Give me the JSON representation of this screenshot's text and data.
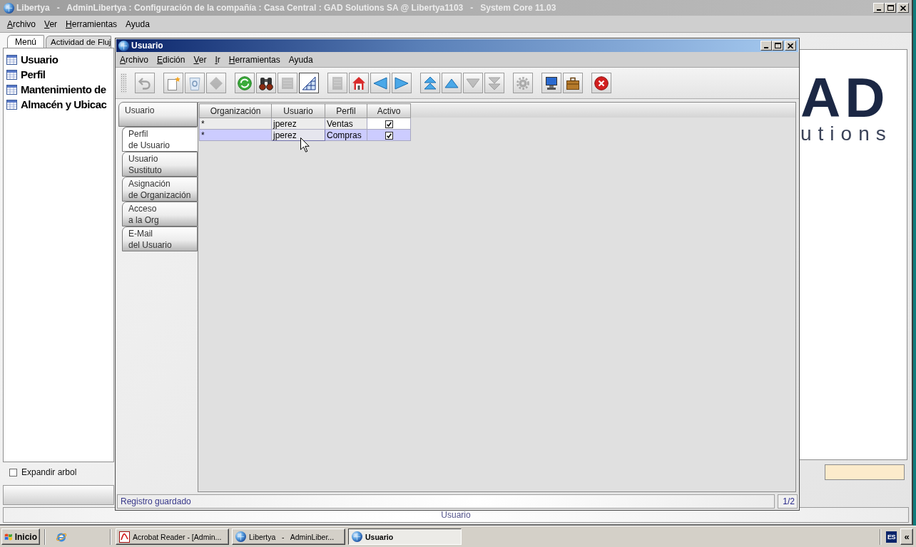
{
  "main_window": {
    "title": "Libertya   -   AdminLibertya : Configuración de la compañía : Casa Central : GAD Solutions SA @ Libertya1103   -   System Core 11.03",
    "menu": [
      {
        "label": "Archivo",
        "mnemonic": true
      },
      {
        "label": "Ver",
        "mnemonic": true
      },
      {
        "label": "Herramientas",
        "mnemonic": true
      },
      {
        "label": "Ayuda",
        "mnemonic": false
      }
    ],
    "tabs": [
      {
        "label": "Menú",
        "selected": true
      },
      {
        "label": "Actividad de Fluj",
        "selected": false
      }
    ],
    "tree": [
      {
        "label": "Usuario"
      },
      {
        "label": "Perfil"
      },
      {
        "label": "Mantenimiento de"
      },
      {
        "label": "Almacén y Ubicac"
      }
    ],
    "expand_tree": {
      "label": "Expandir arbol",
      "checked": false
    },
    "logo": {
      "letters": "AD",
      "subtitle": "utions"
    },
    "status_bar": {
      "text": "Usuario"
    }
  },
  "child_window": {
    "title": "Usuario",
    "menu": [
      {
        "label": "Archivo",
        "mnemonic": true
      },
      {
        "label": "Edición",
        "mnemonic": true
      },
      {
        "label": "Ver",
        "mnemonic": true
      },
      {
        "label": "Ir",
        "mnemonic": true
      },
      {
        "label": "Herramientas",
        "mnemonic": true
      },
      {
        "label": "Ayuda",
        "mnemonic": false
      }
    ],
    "toolbar": [
      [
        {
          "disabled": true,
          "pressed": false
        }
      ],
      [
        {
          "disabled": false,
          "pressed": false
        },
        {
          "disabled": false,
          "pressed": false
        },
        {
          "disabled": true,
          "pressed": false
        }
      ],
      [
        {
          "disabled": false,
          "pressed": false
        },
        {
          "disabled": false,
          "pressed": false
        },
        {
          "disabled": true,
          "pressed": false
        },
        {
          "disabled": false,
          "pressed": true
        }
      ],
      [
        {
          "disabled": true,
          "pressed": false
        },
        {
          "disabled": false,
          "pressed": false
        },
        {
          "disabled": false,
          "pressed": false
        },
        {
          "disabled": false,
          "pressed": false
        }
      ],
      [
        {
          "disabled": false,
          "pressed": false
        },
        {
          "disabled": false,
          "pressed": false
        },
        {
          "disabled": true,
          "pressed": false
        },
        {
          "disabled": true,
          "pressed": false
        }
      ],
      [
        {
          "disabled": true,
          "pressed": false
        }
      ],
      [
        {
          "disabled": false,
          "pressed": false
        },
        {
          "disabled": false,
          "pressed": false
        }
      ],
      [
        {
          "disabled": false,
          "pressed": false
        }
      ]
    ],
    "tabs": [
      {
        "label": "Usuario",
        "selected": false,
        "children": [
          {
            "label": "Perfil\nde Usuario",
            "selected": true
          },
          {
            "label": "Usuario\nSustituto",
            "selected": false
          },
          {
            "label": "Asignación\nde Organización",
            "selected": false
          },
          {
            "label": "Acceso\na la Org",
            "selected": false
          },
          {
            "label": "E-Mail\ndel Usuario",
            "selected": false
          }
        ]
      }
    ],
    "table": {
      "columns": [
        "Organización",
        "Usuario",
        "Perfil",
        "Activo"
      ],
      "rows": [
        {
          "selected": false,
          "cells": [
            {
              "kind": "text",
              "text": "*",
              "focused": false
            },
            {
              "kind": "text",
              "text": "jperez",
              "focused": false
            },
            {
              "kind": "text",
              "text": "Ventas",
              "focused": false
            },
            {
              "kind": "check",
              "checked": true,
              "focused": false
            }
          ]
        },
        {
          "selected": true,
          "cells": [
            {
              "kind": "text",
              "text": "*",
              "focused": false
            },
            {
              "kind": "text",
              "text": "jperez",
              "focused": true
            },
            {
              "kind": "text",
              "text": "Compras",
              "focused": false
            },
            {
              "kind": "check",
              "checked": true,
              "focused": false
            }
          ]
        }
      ]
    },
    "status_bar": {
      "message": "Registro guardado",
      "record": "1/2"
    }
  },
  "taskbar": {
    "start": "Inicio",
    "tasks": [
      {
        "label": "Acrobat Reader - [Admin...",
        "selected": false
      },
      {
        "label": "Libertya   -   AdminLiber...",
        "selected": false
      },
      {
        "label": "Usuario",
        "selected": true
      }
    ],
    "language": "ES",
    "tray_toggle": "«"
  }
}
